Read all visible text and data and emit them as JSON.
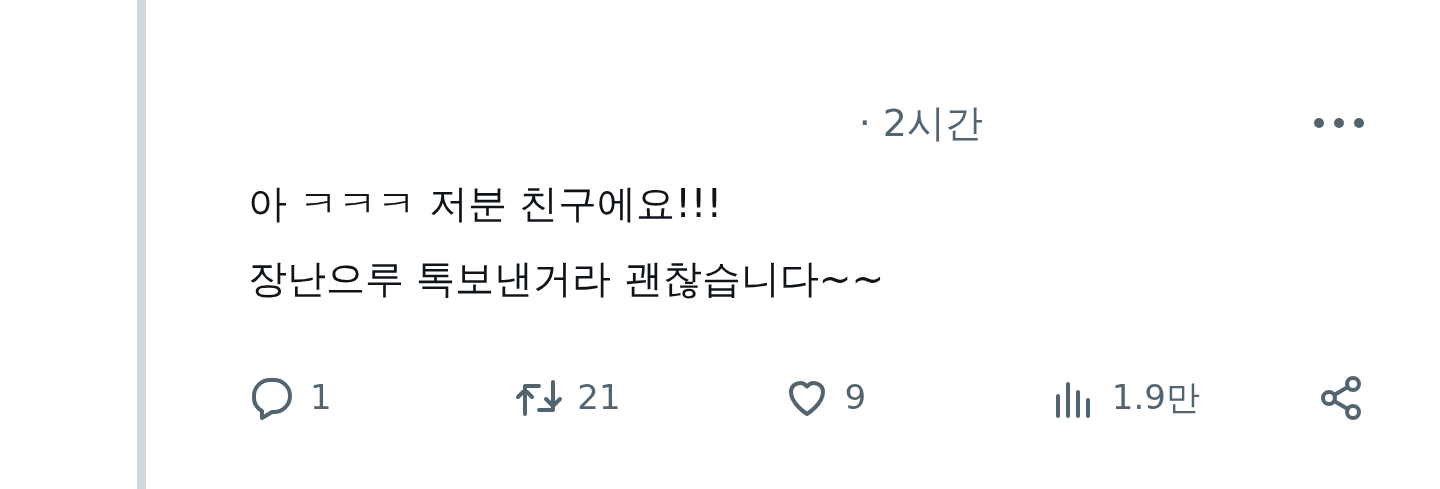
{
  "reply": {
    "time": "· 2시간",
    "lines": [
      "아 ㅋㅋㅋ 저분 친구에요!!!",
      "장난으루 톡보낸거라 괜찮습니다~~"
    ],
    "actions": [
      {
        "kind": "reply",
        "count": "1"
      },
      {
        "kind": "repost",
        "count": "21"
      },
      {
        "kind": "like",
        "count": "9"
      },
      {
        "kind": "views",
        "count": "1.9만"
      },
      {
        "kind": "share"
      }
    ]
  }
}
